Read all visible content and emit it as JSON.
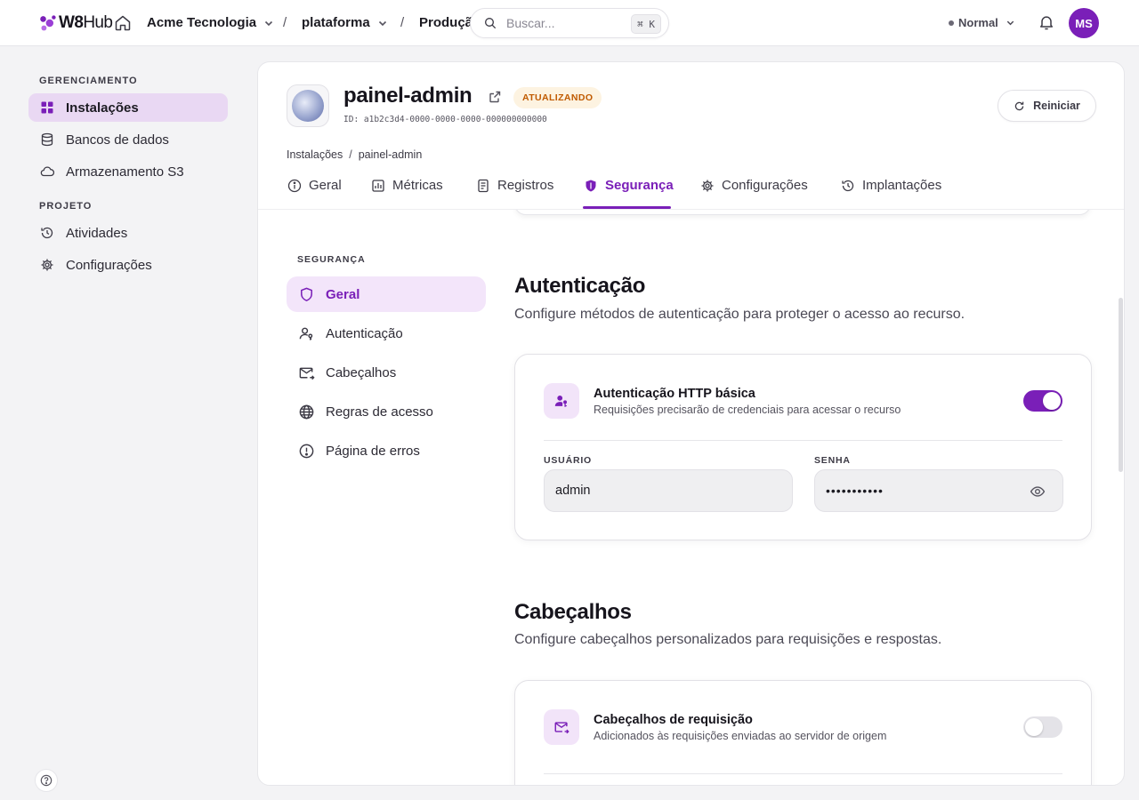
{
  "topbar": {
    "logo_w8": "W8",
    "logo_hub": "Hub",
    "org": "Acme Tecnologia",
    "project": "plataforma",
    "environment": "Produção",
    "separator": "/",
    "search_placeholder": "Buscar...",
    "search_shortcut": "⌘ K",
    "mode_label": "Normal",
    "avatar_initials": "MS"
  },
  "sidebar": {
    "section_manage": "GERENCIAMENTO",
    "manage_items": [
      {
        "label": "Instalações",
        "icon": "grid-icon",
        "active": true
      },
      {
        "label": "Bancos de dados",
        "icon": "database-icon"
      },
      {
        "label": "Armazenamento S3",
        "icon": "cloud-icon"
      }
    ],
    "section_project": "PROJETO",
    "project_items": [
      {
        "label": "Atividades",
        "icon": "history-icon"
      },
      {
        "label": "Configurações",
        "icon": "gear-icon"
      }
    ]
  },
  "resource": {
    "title": "painel-admin",
    "status": "ATUALIZANDO",
    "id": "ID: a1b2c3d4-0000-0000-0000-000000000000",
    "restart_label": "Reiniciar",
    "breadcrumb": [
      "Instalações",
      "painel-admin"
    ],
    "breadcrumb_sep": "/"
  },
  "tabs": [
    {
      "label": "Geral",
      "icon": "info-icon"
    },
    {
      "label": "Métricas",
      "icon": "chart-icon"
    },
    {
      "label": "Registros",
      "icon": "document-icon"
    },
    {
      "label": "Segurança",
      "icon": "shield-icon",
      "active": true
    },
    {
      "label": "Configurações",
      "icon": "gear-icon"
    },
    {
      "label": "Implantações",
      "icon": "history-icon"
    }
  ],
  "security_nav": {
    "heading": "SEGURANÇA",
    "items": [
      {
        "label": "Geral",
        "icon": "shield-icon",
        "active": true
      },
      {
        "label": "Autenticação",
        "icon": "user-key-icon"
      },
      {
        "label": "Cabeçalhos",
        "icon": "mail-arrow-icon"
      },
      {
        "label": "Regras de acesso",
        "icon": "globe-icon"
      },
      {
        "label": "Página de erros",
        "icon": "alert-circle-icon"
      }
    ]
  },
  "auth_section": {
    "title": "Autenticação",
    "description": "Configure métodos de autenticação para proteger o acesso ao recurso.",
    "card": {
      "title": "Autenticação HTTP básica",
      "description": "Requisições precisarão de credenciais para acessar o recurso",
      "enabled": true,
      "user_label": "USUÁRIO",
      "user_value": "admin",
      "password_label": "SENHA",
      "password_value": "•••••••••••"
    }
  },
  "headers_section": {
    "title": "Cabeçalhos",
    "description": "Configure cabeçalhos personalizados para requisições e respostas.",
    "card": {
      "title": "Cabeçalhos de requisição",
      "description": "Adicionados às requisições enviadas ao servidor de origem",
      "enabled": false
    }
  },
  "colors": {
    "accent": "#7a1fb8",
    "accent_soft": "#f3e5fa",
    "badge_bg": "#fdf3e1",
    "badge_text": "#c05a00"
  }
}
